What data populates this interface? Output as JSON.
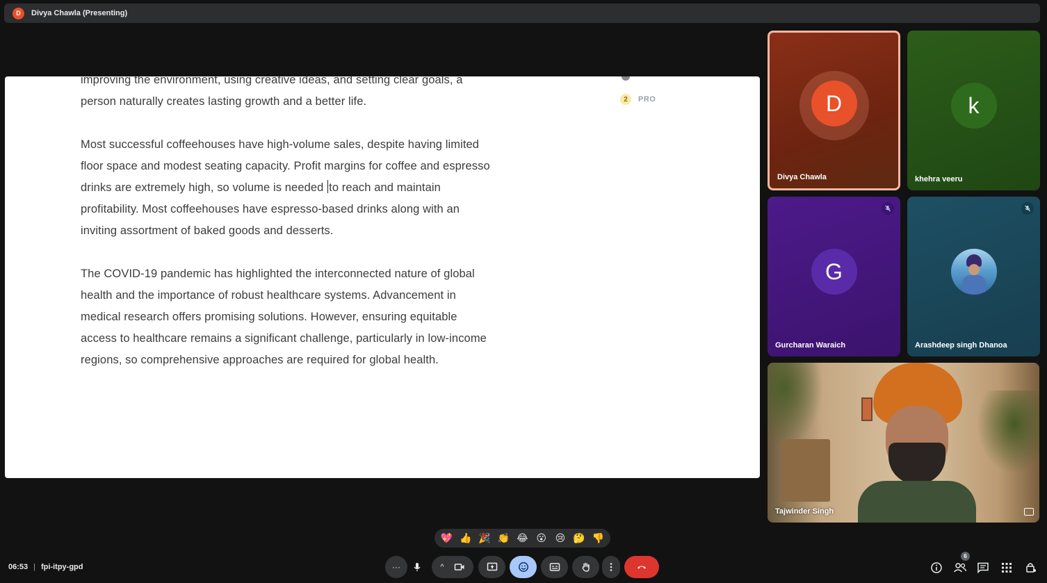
{
  "presenter_bar": {
    "avatar_letter": "D",
    "title": "Divya Chawla (Presenting)"
  },
  "document": {
    "paragraphs": [
      "improving the environment, using creative ideas, and setting clear goals, a person naturally creates lasting growth and a better life.",
      "Most successful coffeehouses have high-volume sales, despite having limited floor space and modest seating capacity. Profit margins for coffee and espresso drinks are extremely high, so volume is needed",
      "to reach and maintain profitability. Most coffeehouses have espresso-based drinks along with an inviting assortment of baked goods and desserts.",
      "The COVID-19 pandemic has highlighted the interconnected nature of global health and the importance of robust healthcare systems. Advancement in medical research offers promising solutions. However, ensuring equitable access to healthcare remains a significant challenge, particularly in low-income regions, so comprehensive approaches are required for global health."
    ],
    "marker_number": "2",
    "marker_label": "PRO"
  },
  "participants": [
    {
      "name": "Divya Chawla",
      "letter": "D",
      "color": "#e8512a"
    },
    {
      "name": "khehra veeru",
      "letter": "k",
      "color": "#2f6b1c"
    },
    {
      "name": "Gurcharan Waraich",
      "letter": "G",
      "color": "#5a2ba8"
    },
    {
      "name": "Arashdeep singh Dhanoa",
      "letter": ""
    },
    {
      "name": "Tajwinder Singh",
      "letter": ""
    }
  ],
  "reactions": [
    "💖",
    "👍",
    "🎉",
    "👏",
    "😂",
    "😮",
    "😢",
    "🤔",
    "👎"
  ],
  "meeting": {
    "time": "06:53",
    "separator": "|",
    "code": "fpi-itpy-gpd"
  },
  "controls": {
    "more_dots": "···",
    "caret": "^",
    "people_count": "6"
  },
  "colors": {
    "accent": "#a8c7fa",
    "end_call": "#dc362e",
    "background": "#121212"
  }
}
